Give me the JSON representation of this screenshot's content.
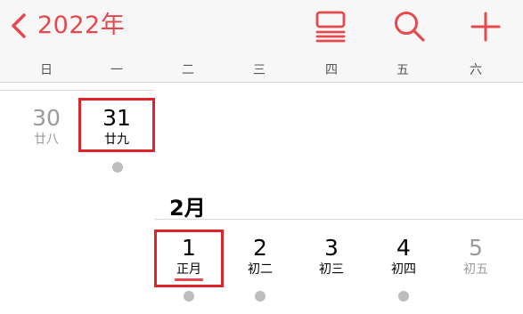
{
  "header": {
    "back_label": "2022年",
    "icons": [
      "list-view-icon",
      "search-icon",
      "add-icon"
    ],
    "accent": "#e5484d"
  },
  "weekdays": [
    "日",
    "一",
    "二",
    "三",
    "四",
    "五",
    "六"
  ],
  "january": {
    "days": [
      {
        "num": "30",
        "lunar": "廿八"
      },
      {
        "num": "31",
        "lunar": "廿九"
      }
    ]
  },
  "february": {
    "title": "2月",
    "days": [
      {
        "num": "1",
        "lunar": "正月"
      },
      {
        "num": "2",
        "lunar": "初二"
      },
      {
        "num": "3",
        "lunar": "初三"
      },
      {
        "num": "4",
        "lunar": "初四"
      },
      {
        "num": "5",
        "lunar": "初五"
      }
    ]
  }
}
